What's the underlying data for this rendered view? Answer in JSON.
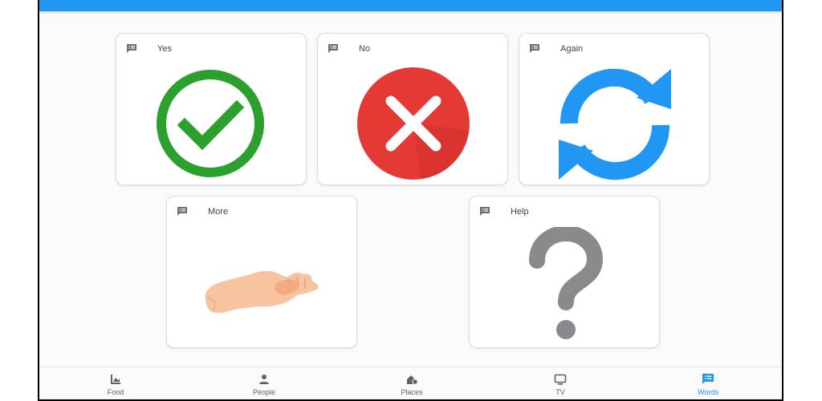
{
  "colors": {
    "accent": "#2196f3",
    "yes": "#2ca02c",
    "no": "#e53935",
    "again": "#2196f3",
    "help": "#8a8a8e"
  },
  "cards": [
    {
      "label": "Yes",
      "icon": "check-circle-icon"
    },
    {
      "label": "No",
      "icon": "cross-circle-icon"
    },
    {
      "label": "Again",
      "icon": "refresh-arrows-icon"
    },
    {
      "label": "More",
      "icon": "open-hand-icon"
    },
    {
      "label": "Help",
      "icon": "question-mark-icon"
    }
  ],
  "nav": {
    "items": [
      {
        "label": "Food",
        "icon": "food-icon"
      },
      {
        "label": "People",
        "icon": "person-icon"
      },
      {
        "label": "Places",
        "icon": "places-icon"
      },
      {
        "label": "TV",
        "icon": "tv-icon"
      },
      {
        "label": "Words",
        "icon": "words-icon",
        "active": true
      }
    ]
  }
}
